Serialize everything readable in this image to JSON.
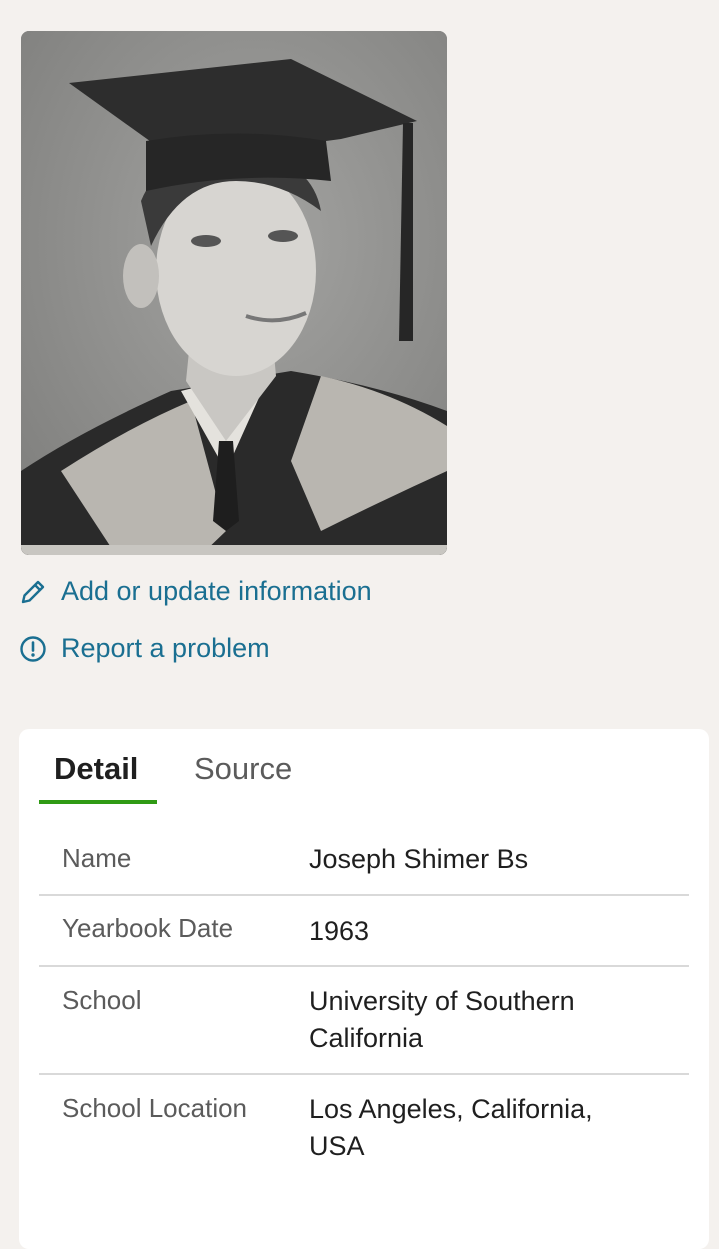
{
  "photo": {
    "alt": "Yearbook portrait of a graduate in cap and gown"
  },
  "actions": {
    "edit": {
      "label": "Add or update information",
      "icon": "pencil-icon"
    },
    "report": {
      "label": "Report a problem",
      "icon": "alert-circle-icon"
    }
  },
  "colors": {
    "link": "#1a6f91",
    "tab_active_underline": "#2f9a14",
    "background": "#f4f1ee"
  },
  "tabs": [
    {
      "label": "Detail",
      "active": true
    },
    {
      "label": "Source",
      "active": false
    }
  ],
  "details": [
    {
      "label": "Name",
      "value": "Joseph Shimer Bs"
    },
    {
      "label": "Yearbook Date",
      "value": "1963"
    },
    {
      "label": "School",
      "value": "University of Southern California"
    },
    {
      "label": "School Location",
      "value": "Los Angeles, California, USA"
    }
  ]
}
